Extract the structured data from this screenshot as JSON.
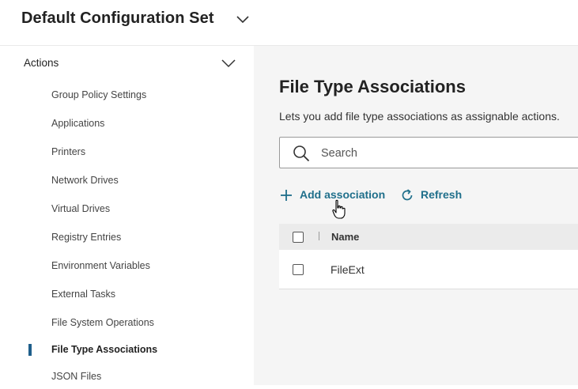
{
  "header": {
    "title": "Default Configuration Set"
  },
  "sidebar": {
    "section_label": "Actions",
    "items": [
      {
        "label": "Group Policy Settings"
      },
      {
        "label": "Applications"
      },
      {
        "label": "Printers"
      },
      {
        "label": "Network Drives"
      },
      {
        "label": "Virtual Drives"
      },
      {
        "label": "Registry Entries"
      },
      {
        "label": "Environment Variables"
      },
      {
        "label": "External Tasks"
      },
      {
        "label": "File System Operations"
      },
      {
        "label": "File Type Associations",
        "active": true
      },
      {
        "label": "JSON Files"
      }
    ]
  },
  "main": {
    "title": "File Type Associations",
    "description": "Lets you add file type associations as assignable actions.",
    "search": {
      "placeholder": "Search",
      "value": ""
    },
    "toolbar": {
      "add_label": "Add association",
      "refresh_label": "Refresh"
    },
    "table": {
      "columns": [
        "Name"
      ],
      "rows": [
        {
          "name": "FileExt"
        }
      ]
    }
  },
  "colors": {
    "accent": "#1f6f8b",
    "active_indicator": "#1f5f8b",
    "main_background": "#f5f5f5"
  },
  "icons": {
    "config_chevron": "chevron-down-icon",
    "section_chevron": "chevron-down-icon",
    "search": "search-icon",
    "add": "plus-icon",
    "refresh": "refresh-icon",
    "cursor": "hand-pointer-cursor-icon"
  }
}
